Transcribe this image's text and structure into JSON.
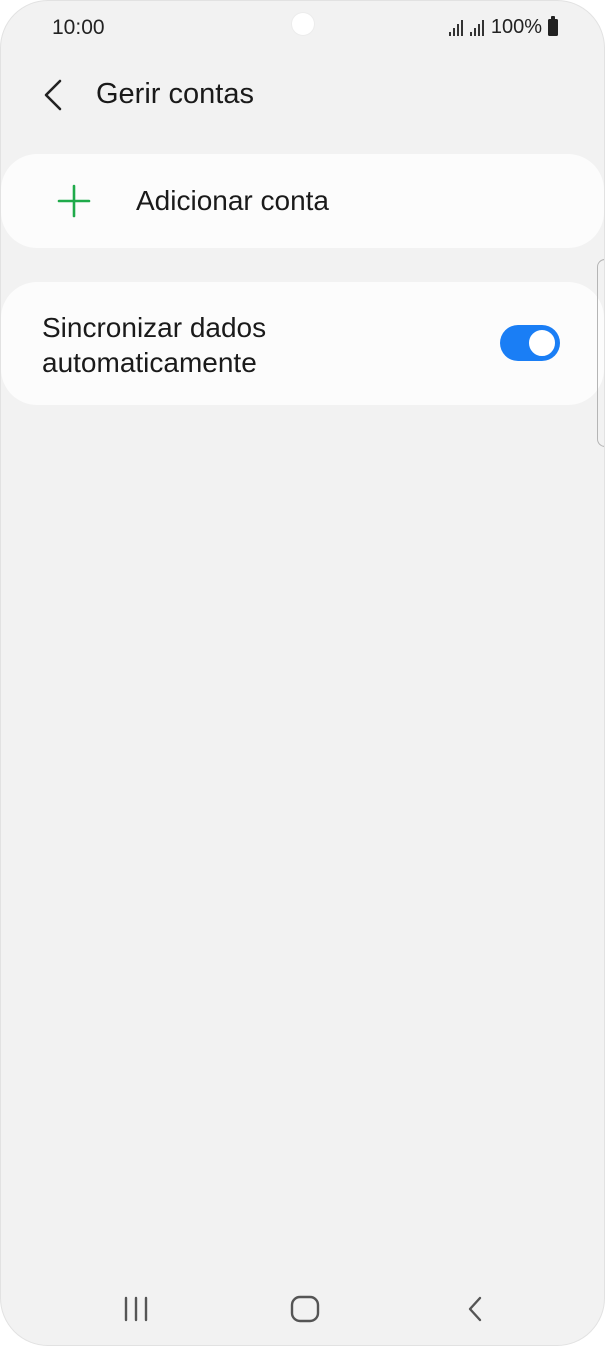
{
  "status_bar": {
    "time": "10:00",
    "battery": "100%"
  },
  "header": {
    "title": "Gerir contas"
  },
  "add_account": {
    "label": "Adicionar conta",
    "icon": "plus-icon",
    "icon_color": "#1faa4a"
  },
  "sync": {
    "label": "Sincronizar dados automaticamente",
    "enabled": true,
    "toggle_color": "#1a7ef5"
  },
  "nav_bar": {
    "recents_icon": "recents-icon",
    "home_icon": "home-icon",
    "back_icon": "back-icon"
  }
}
